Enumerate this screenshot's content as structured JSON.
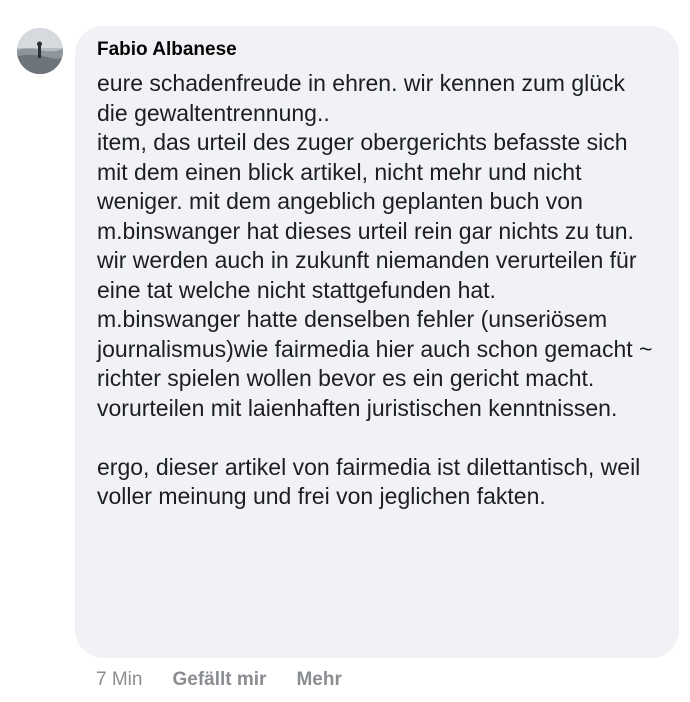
{
  "comment": {
    "author": "Fabio Albanese",
    "paragraphs": [
      "eure schadenfreude in ehren. wir kennen zum glück die gewaltentrennung..",
      "item, das urteil des zuger obergerichts befasste sich mit dem einen blick artikel, nicht mehr und nicht weniger. mit dem angeblich geplanten buch von m.binswanger hat dieses urteil rein gar nichts zu tun.",
      "wir werden auch in zukunft niemanden verurteilen für eine tat welche nicht stattgefunden hat.",
      "m.binswanger hatte denselben fehler (unseriösem journalismus)wie fairmedia hier auch schon gemacht ~ richter spielen wollen bevor es ein gericht macht. vorurteilen mit laienhaften juristischen kenntnissen.",
      "ergo, dieser artikel von fairmedia ist dilettantisch, weil voller meinung und frei von jeglichen fakten."
    ],
    "time": "7 Min",
    "like_label": "Gefällt mir",
    "more_label": "Mehr"
  },
  "colors": {
    "bubble_bg": "#f0f2f5",
    "text": "#1c1e21",
    "meta": "#8a8d91"
  }
}
